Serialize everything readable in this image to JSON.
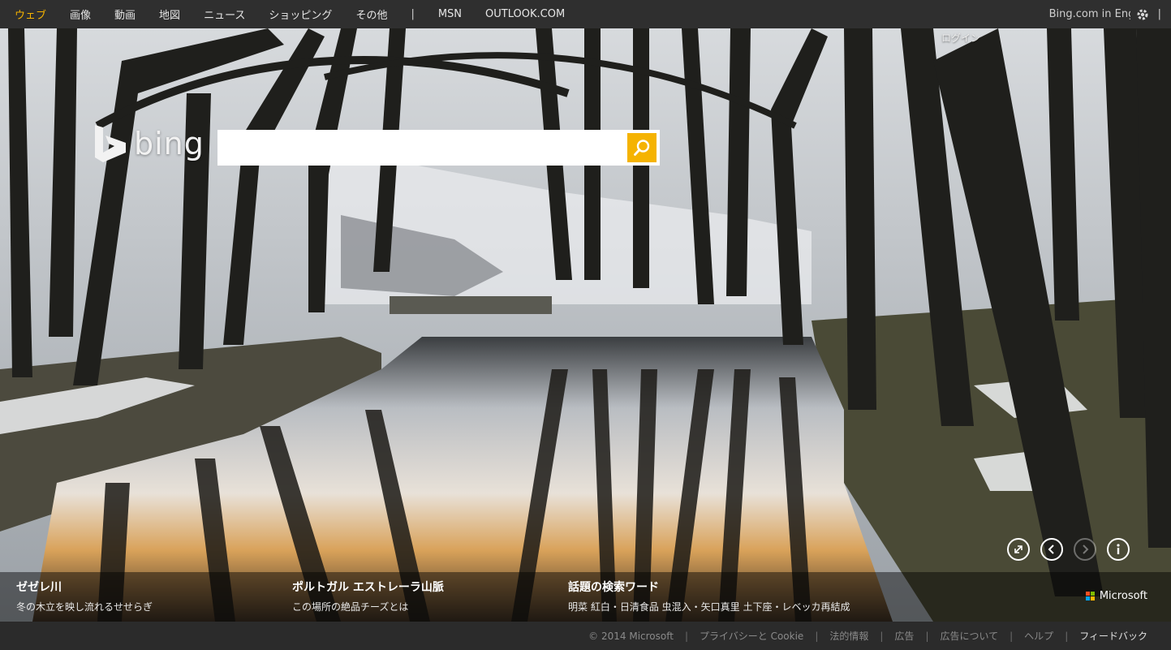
{
  "nav": {
    "items": [
      {
        "label": "ウェブ",
        "active": true
      },
      {
        "label": "画像",
        "active": false
      },
      {
        "label": "動画",
        "active": false
      },
      {
        "label": "地図",
        "active": false
      },
      {
        "label": "ニュース",
        "active": false
      },
      {
        "label": "ショッピング",
        "active": false
      },
      {
        "label": "その他",
        "active": false
      }
    ],
    "separator": "|",
    "extra": [
      "MSN",
      "OUTLOOK.COM"
    ],
    "lang_link": "Bing.com in English",
    "settings_icon": "gear-icon",
    "trailing_separator": "|"
  },
  "login": {
    "label": "ログイン"
  },
  "logo": {
    "icon": "bing-logo-icon",
    "word": "bing"
  },
  "search": {
    "value": "",
    "placeholder": "",
    "button_icon": "search-icon",
    "accent": "#f5b301"
  },
  "controls": [
    {
      "name": "fullscreen-icon",
      "glyph": "⤢"
    },
    {
      "name": "previous-icon",
      "glyph": "‹"
    },
    {
      "name": "next-icon",
      "glyph": "›"
    },
    {
      "name": "info-icon",
      "glyph": "i"
    }
  ],
  "captions": [
    {
      "title": "ゼゼレ川",
      "subtitle": "冬の木立を映し流れるせせらぎ"
    },
    {
      "title": "ポルトガル エストレーラ山脈",
      "subtitle": "この場所の絶品チーズとは"
    },
    {
      "title": "話題の検索ワード",
      "subtitle": "明菜 紅白・日清食品 虫混入・矢口真里 土下座・レベッカ再結成"
    }
  ],
  "brand": {
    "label": "Microsoft",
    "colors": [
      "#f25022",
      "#7fba00",
      "#00a4ef",
      "#ffb900"
    ]
  },
  "footer": {
    "items": [
      {
        "label": "© 2014 Microsoft",
        "highlight": false
      },
      {
        "label": "プライバシーと Cookie",
        "highlight": false
      },
      {
        "label": "法的情報",
        "highlight": false
      },
      {
        "label": "広告",
        "highlight": false
      },
      {
        "label": "広告について",
        "highlight": false
      },
      {
        "label": "ヘルプ",
        "highlight": false
      },
      {
        "label": "フィードバック",
        "highlight": true
      }
    ],
    "separator": "|"
  }
}
